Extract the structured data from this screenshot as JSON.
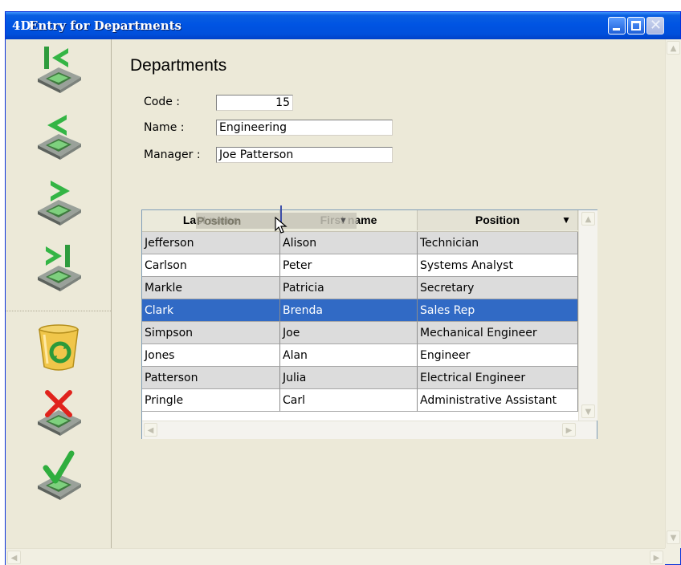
{
  "window": {
    "logo": "4D",
    "title": "Entry for Departments"
  },
  "toolbar": {
    "buttons": [
      {
        "name": "first-record",
        "icon": "first-record-icon"
      },
      {
        "name": "previous-record",
        "icon": "previous-record-icon"
      },
      {
        "name": "next-record",
        "icon": "next-record-icon"
      },
      {
        "name": "last-record",
        "icon": "last-record-icon"
      },
      {
        "name": "delete-record",
        "icon": "recycle-bin-icon"
      },
      {
        "name": "cancel",
        "icon": "cancel-x-icon"
      },
      {
        "name": "accept",
        "icon": "accept-check-icon"
      }
    ]
  },
  "form": {
    "heading": "Departments",
    "code_label": "Code :",
    "code_value": "15",
    "name_label": "Name :",
    "name_value": "Engineering",
    "manager_label": "Manager :",
    "manager_value": "Joe Patterson"
  },
  "grid": {
    "headers": [
      "Last name",
      "First name",
      "Position"
    ],
    "drag_ghost": "Position",
    "sort_indicator": "▼",
    "rows": [
      [
        "Jefferson",
        "Alison",
        "Technician"
      ],
      [
        "Carlson",
        "Peter",
        "Systems Analyst"
      ],
      [
        "Markle",
        "Patricia",
        "Secretary"
      ],
      [
        "Clark",
        "Brenda",
        "Sales Rep"
      ],
      [
        "Simpson",
        "Joe",
        "Mechanical Engineer"
      ],
      [
        "Jones",
        "Alan",
        "Engineer"
      ],
      [
        "Patterson",
        "Julia",
        "Electrical Engineer"
      ],
      [
        "Pringle",
        "Carl",
        "Administrative Assistant"
      ]
    ],
    "selected_row": 3
  },
  "colors": {
    "titlebar": "#0054e3",
    "selection": "#316ac5",
    "window_bg": "#ece9d8"
  }
}
